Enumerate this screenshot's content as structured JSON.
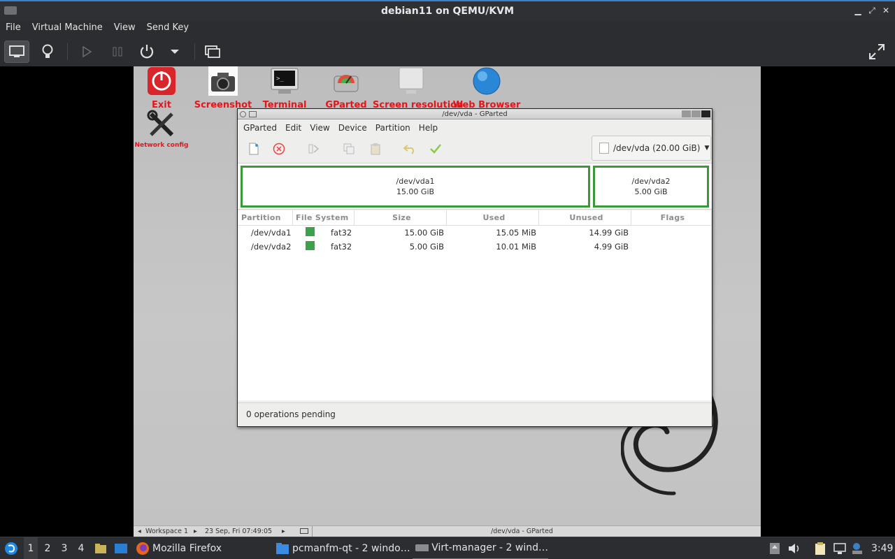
{
  "window": {
    "title": "debian11 on QEMU/KVM"
  },
  "menu": [
    "File",
    "Virtual Machine",
    "View",
    "Send Key"
  ],
  "desktop_icons": [
    {
      "label": "Exit"
    },
    {
      "label": "Screenshot"
    },
    {
      "label": "Terminal"
    },
    {
      "label": "GParted"
    },
    {
      "label": "Screen resolution"
    },
    {
      "label": "Web Browser"
    },
    {
      "label": "Network config"
    }
  ],
  "gparted": {
    "title": "/dev/vda - GParted",
    "menu": [
      "GParted",
      "Edit",
      "View",
      "Device",
      "Partition",
      "Help"
    ],
    "device": "/dev/vda (20.00 GiB)",
    "map": [
      {
        "name": "/dev/vda1",
        "size": "15.00 GiB"
      },
      {
        "name": "/dev/vda2",
        "size": "5.00 GiB"
      }
    ],
    "columns": [
      "Partition",
      "File System",
      "Size",
      "Used",
      "Unused",
      "Flags"
    ],
    "rows": [
      {
        "partition": "/dev/vda1",
        "fs": "fat32",
        "size": "15.00 GiB",
        "used": "15.05 MiB",
        "unused": "14.99 GiB",
        "flags": "",
        "color": "#3aa34a"
      },
      {
        "partition": "/dev/vda2",
        "fs": "fat32",
        "size": "5.00 GiB",
        "used": "10.01 MiB",
        "unused": "4.99 GiB",
        "flags": "",
        "color": "#3aa34a"
      }
    ],
    "status": "0 operations pending"
  },
  "vm_panel": {
    "workspace": "Workspace 1",
    "datetime": "23 Sep, Fri 07:49:05",
    "task": "/dev/vda - GParted"
  },
  "taskbar": {
    "workspaces": [
      "1",
      "2",
      "3",
      "4"
    ],
    "tasks": [
      "Mozilla Firefox",
      "pcmanfm-qt - 2 windo…",
      "Virt-manager - 2 wind…"
    ],
    "clock": "3:49"
  },
  "colors": {
    "accent": "#3c7fc4",
    "partition_border": "#3a9a3a",
    "desktop_label": "#e8141a"
  }
}
